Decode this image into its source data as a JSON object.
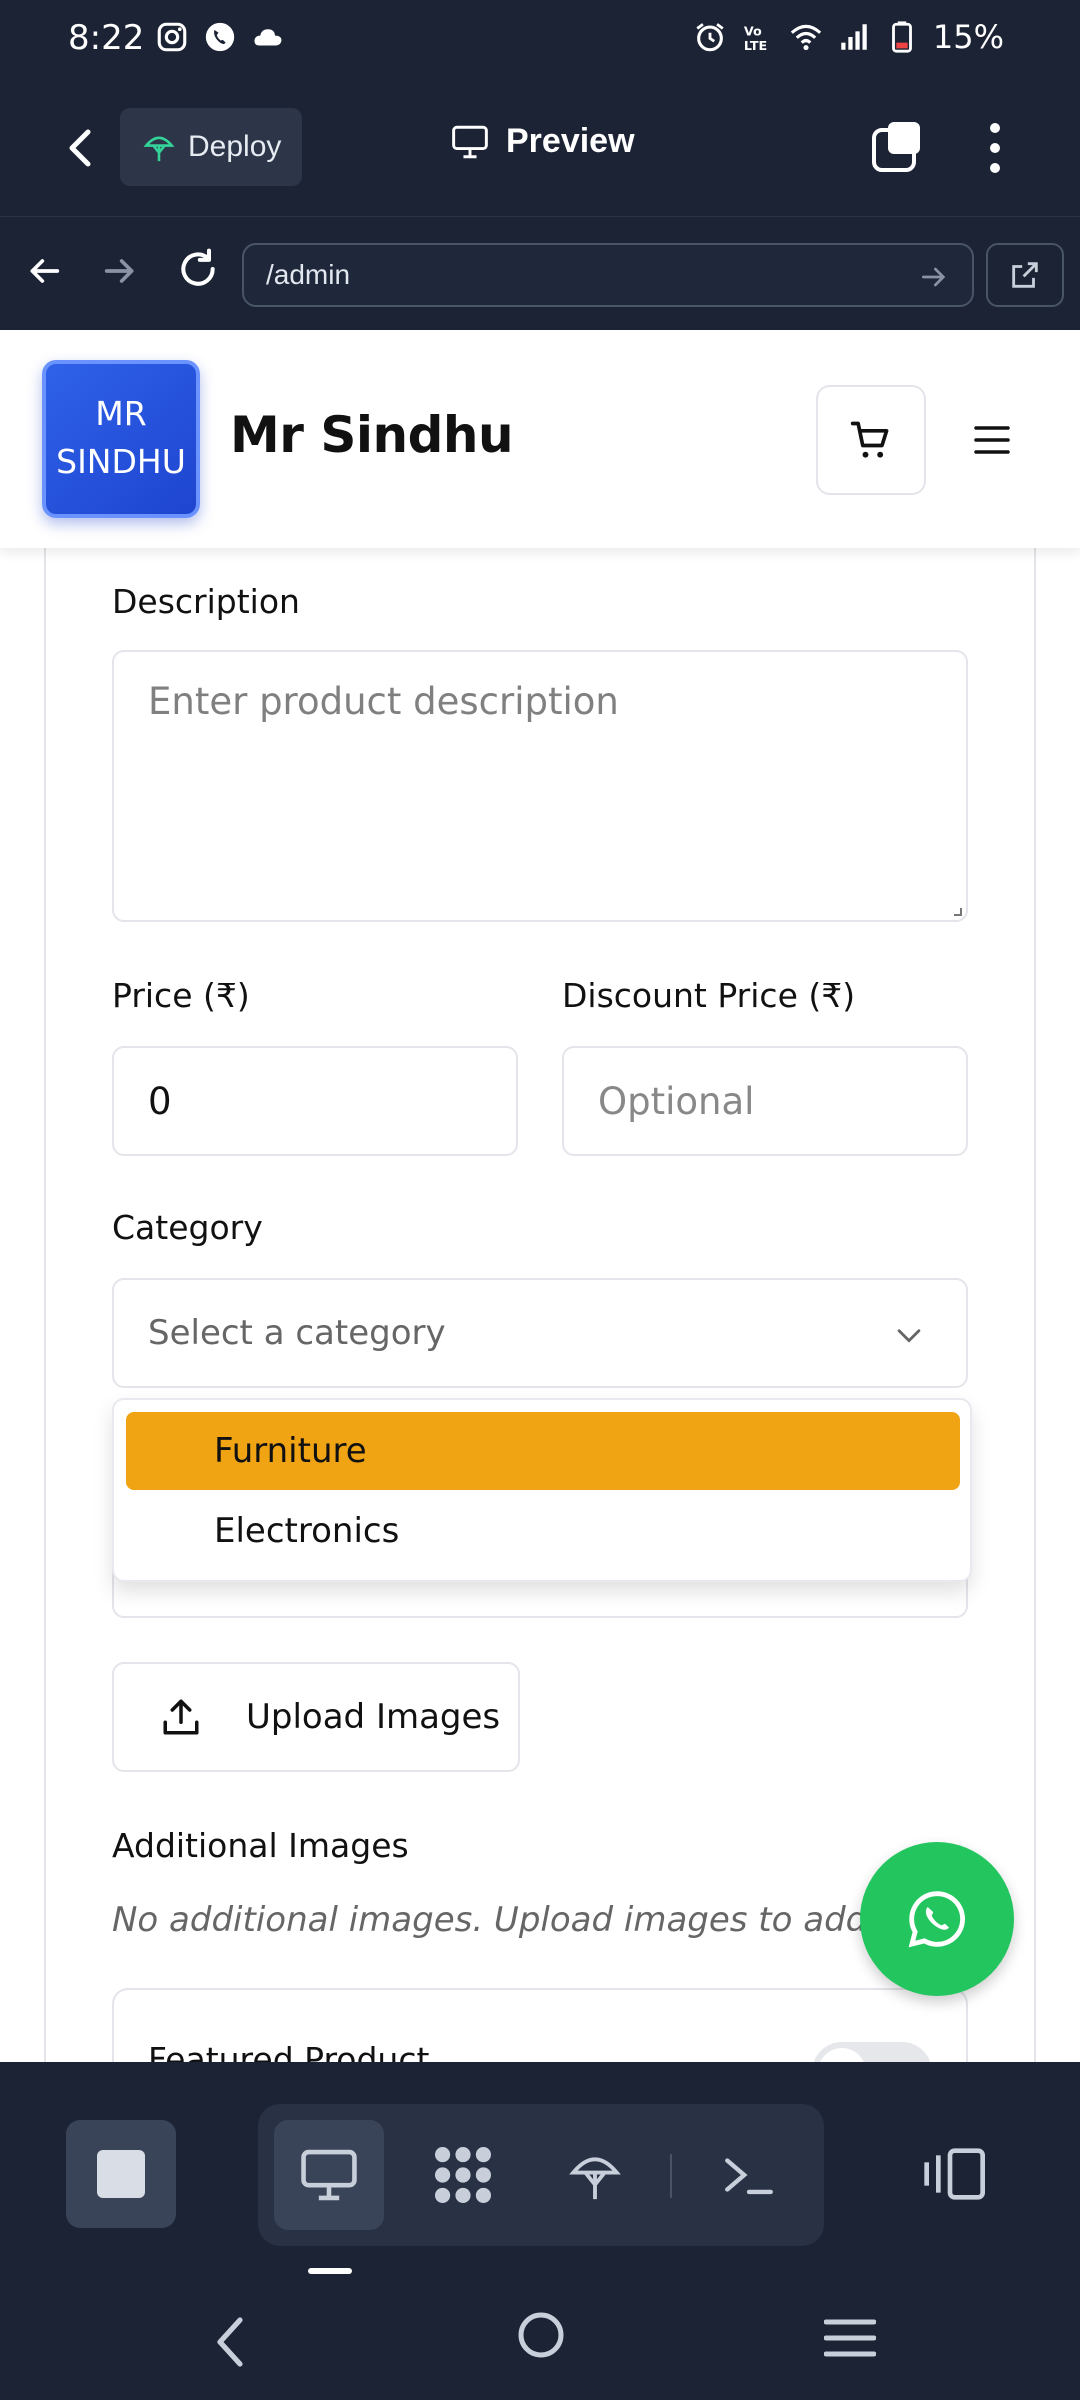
{
  "status_bar": {
    "time": "8:22",
    "battery": "15%"
  },
  "app_header": {
    "deploy_label": "Deploy",
    "preview_label": "Preview"
  },
  "url_bar": {
    "url": "/admin"
  },
  "site": {
    "logo_line1": "MR",
    "logo_line2": "SINDHU",
    "title": "Mr Sindhu"
  },
  "form": {
    "description_label": "Description",
    "description_placeholder": "Enter product description",
    "price_label": "Price (₹)",
    "price_value": "0",
    "discount_label": "Discount Price (₹)",
    "discount_placeholder": "Optional",
    "category_label": "Category",
    "category_placeholder": "Select a category",
    "category_options": [
      "Furniture",
      "Electronics"
    ],
    "category_highlighted": "Furniture",
    "upload_label": "Upload Images",
    "additional_images_label": "Additional Images",
    "additional_images_hint": "No additional images. Upload images to add them",
    "featured_label": "Featured Product",
    "featured_enabled": false
  },
  "colors": {
    "accent": "#f0a313",
    "whatsapp": "#22c55e",
    "logo": "#2f61e9",
    "chrome": "#1b2335"
  },
  "icons": {
    "cart": "cart-icon",
    "menu": "hamburger-icon",
    "upload": "upload-icon",
    "whatsapp": "whatsapp-icon"
  }
}
